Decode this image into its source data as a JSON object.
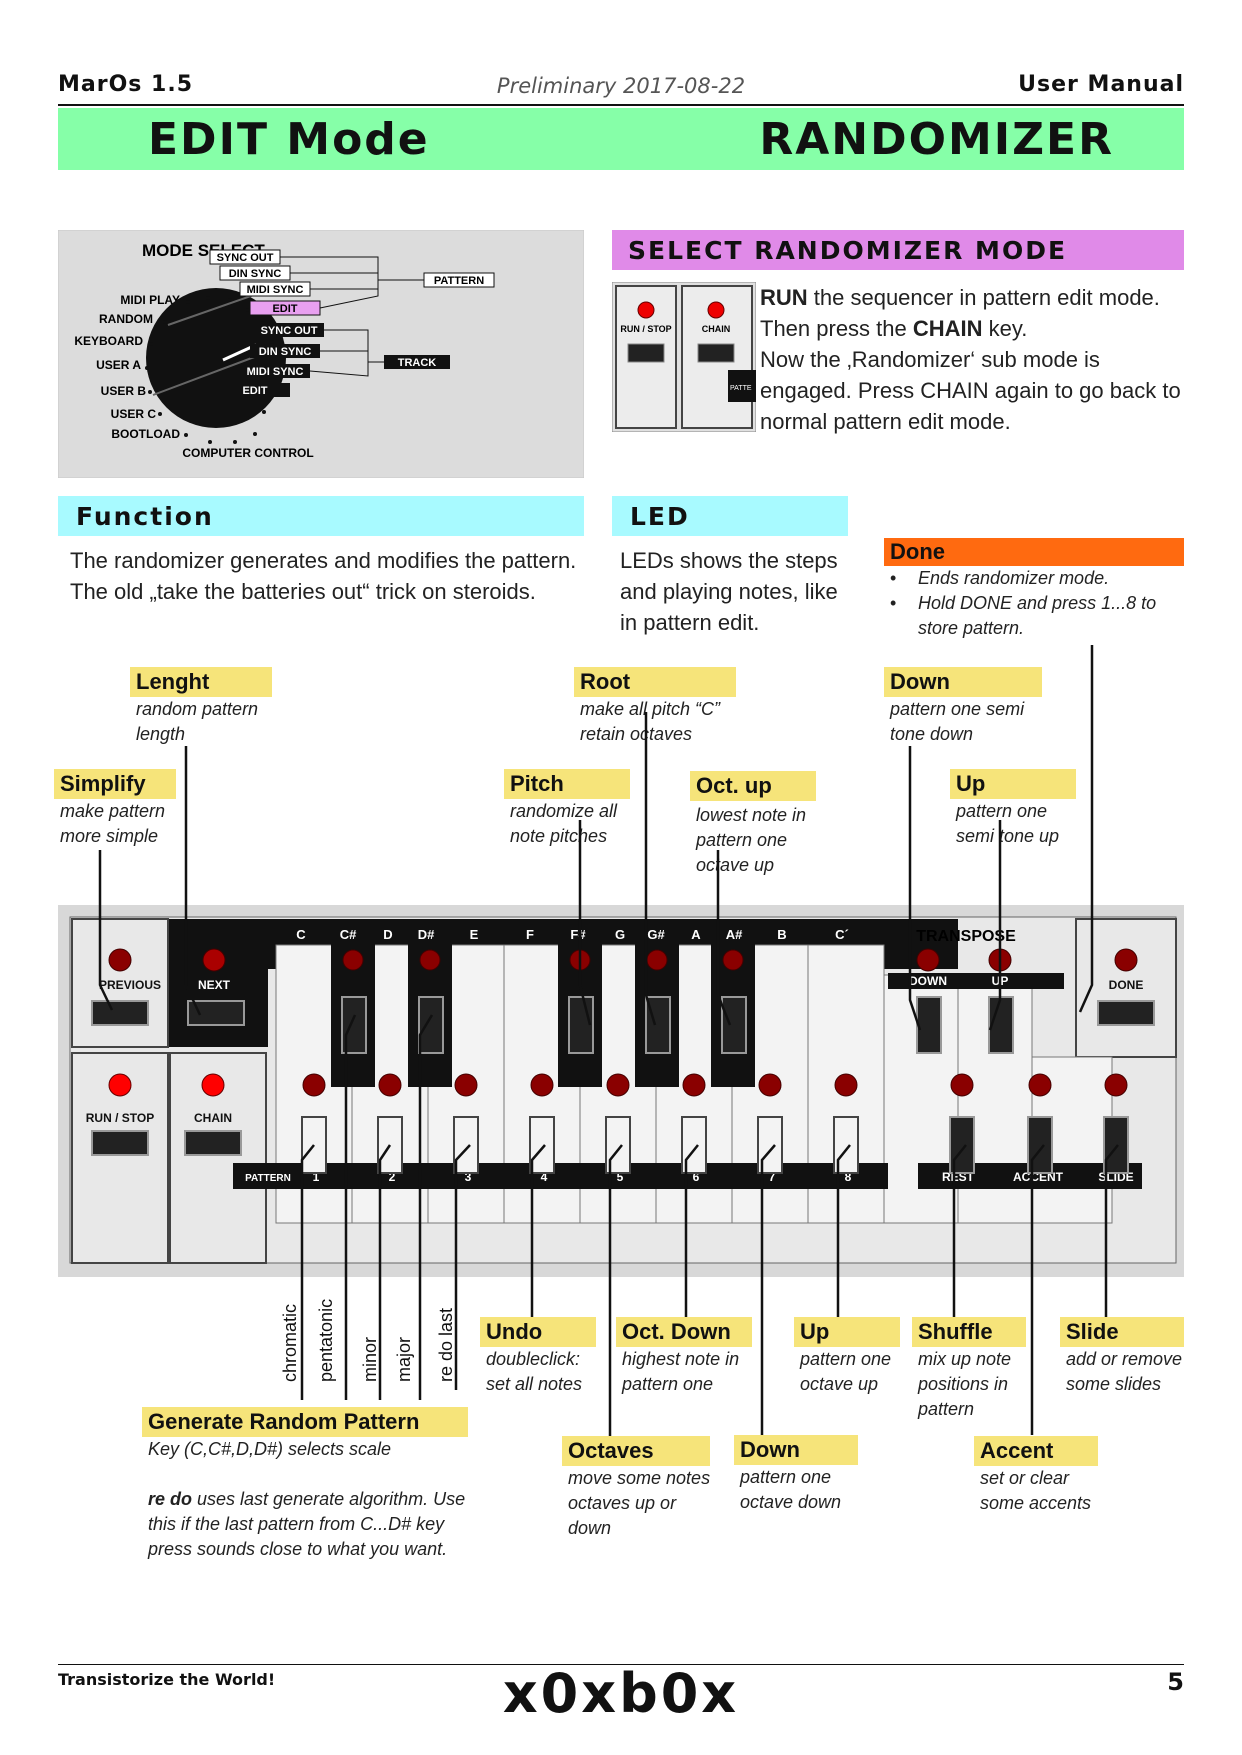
{
  "header": {
    "product": "MarOs 1.5",
    "date": "Preliminary 2017-08-22",
    "doc": "User Manual"
  },
  "banner": {
    "left": "EDIT Mode",
    "right": "RANDOMIZER"
  },
  "mode_select": {
    "title": "MODE SELECT",
    "left_labels": [
      "MIDI PLAY",
      "RANDOM",
      "KEYBOARD",
      "USER A",
      "USER B",
      "USER C",
      "BOOTLOAD"
    ],
    "bottom": "COMPUTER CONTROL",
    "right_labels": [
      "SYNC OUT",
      "DIN SYNC",
      "MIDI SYNC",
      "EDIT",
      "SYNC OUT",
      "DIN SYNC",
      "MIDI SYNC",
      "EDIT"
    ],
    "group_pattern": "PATTERN",
    "group_track": "TRACK"
  },
  "select_mode": {
    "title": "SELECT RANDOMIZER MODE",
    "btn_run": "RUN / STOP",
    "btn_chain": "CHAIN",
    "patt": "PATTE",
    "p1_bold": "RUN",
    "p1_rest": " the sequencer in pattern edit mode.",
    "p2_a": "Then press the ",
    "p2_bold": "CHAIN",
    "p2_b": " key.",
    "p3": "Now the ‚Randomizer‘ sub mode is engaged. Press CHAIN again to go back to normal pattern edit mode."
  },
  "function": {
    "title": "Function",
    "text": "The randomizer generates and modifies the pattern.  The old „take the batteries out“ trick on steroids."
  },
  "led": {
    "title": "LED",
    "text": "LEDs shows the steps and playing notes, like in pattern edit."
  },
  "done": {
    "title": "Done",
    "bullets": [
      "Ends randomizer mode.",
      "Hold DONE and press 1...8 to store pattern."
    ]
  },
  "callouts": {
    "lenght": {
      "title": "Lenght",
      "note": "random pattern length"
    },
    "root": {
      "title": "Root",
      "note": "make all pitch “C” retain octaves"
    },
    "down_semi": {
      "title": "Down",
      "note": "pattern one semi tone down"
    },
    "simplify": {
      "title": "Simplify",
      "note": "make pattern more simple"
    },
    "pitch": {
      "title": "Pitch",
      "note": "randomize all note pitches"
    },
    "oct_up": {
      "title": "Oct. up",
      "note": "lowest note in pattern one octave up"
    },
    "up_semi": {
      "title": "Up",
      "note": "pattern one semi tone up"
    },
    "undo": {
      "title": "Undo",
      "note": "doubleclick: set all notes"
    },
    "oct_down": {
      "title": "Oct. Down",
      "note": "highest note in pattern one"
    },
    "up_oct": {
      "title": "Up",
      "note": "pattern one octave up"
    },
    "shuffle": {
      "title": "Shuffle",
      "note": "mix up note positions in pattern"
    },
    "slide": {
      "title": "Slide",
      "note": "add or remove some slides"
    },
    "octaves": {
      "title": "Octaves",
      "note": "move some notes octaves up or down"
    },
    "down_oct": {
      "title": "Down",
      "note": "pattern one octave down"
    },
    "accent": {
      "title": "Accent",
      "note": "set or clear some accents"
    },
    "generate": {
      "title": "Generate Random Pattern",
      "note1": "Key (C,C#,D,D#) selects scale",
      "note2_bold": "re do",
      "note2_rest": " uses last generate algorithm. Use this if the last pattern from C...D# key press sounds close to what you want."
    }
  },
  "scales": [
    "chromatic",
    "pentatonic",
    "minor",
    "major",
    "re do last"
  ],
  "keyboard": {
    "notes": [
      "C",
      "C#",
      "D",
      "D#",
      "E",
      "F",
      "F#",
      "G",
      "G#",
      "A",
      "A#",
      "B",
      "C´"
    ],
    "transpose": "TRANSPOSE",
    "down": "DOWN",
    "up": "UP",
    "done": "DONE",
    "previous": "PREVIOUS",
    "next": "NEXT",
    "run_stop": "RUN / STOP",
    "chain": "CHAIN",
    "pattern": "PATTERN",
    "steps": [
      "1",
      "2",
      "3",
      "4",
      "5",
      "6",
      "7",
      "8"
    ],
    "rest": "REST",
    "accent": "ACCENT",
    "slide": "SLIDE"
  },
  "footer": {
    "tagline": "Transistorize the World!",
    "logo": "x0xb0x",
    "page": "5"
  }
}
